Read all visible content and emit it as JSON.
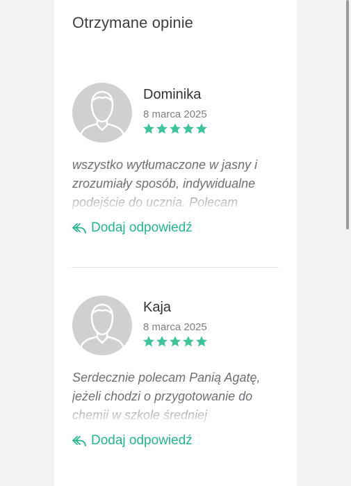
{
  "section": {
    "title": "Otrzymane opinie"
  },
  "colors": {
    "accent": "#26b38f",
    "star": "#3ec39b",
    "avatar_bg": "#d0d0d0"
  },
  "reviews": [
    {
      "author": "Dominika",
      "date": "8 marca 2025",
      "rating": 5,
      "text": "wszystko wytłumaczone w jasny i zrozumiały sposób, indywidualne podejście do ucznia. Polecam",
      "reply_label": "Dodaj odpowiedź",
      "avatar_icon": "user-avatar-icon",
      "reply_icon": "reply-arrow-icon"
    },
    {
      "author": "Kaja",
      "date": "8 marca 2025",
      "rating": 5,
      "text": "Serdecznie polecam Panią Agatę, jeżeli chodzi o przygotowanie do chemii w szkole średniej",
      "reply_label": "Dodaj odpowiedź",
      "avatar_icon": "user-avatar-icon",
      "reply_icon": "reply-arrow-icon"
    }
  ]
}
